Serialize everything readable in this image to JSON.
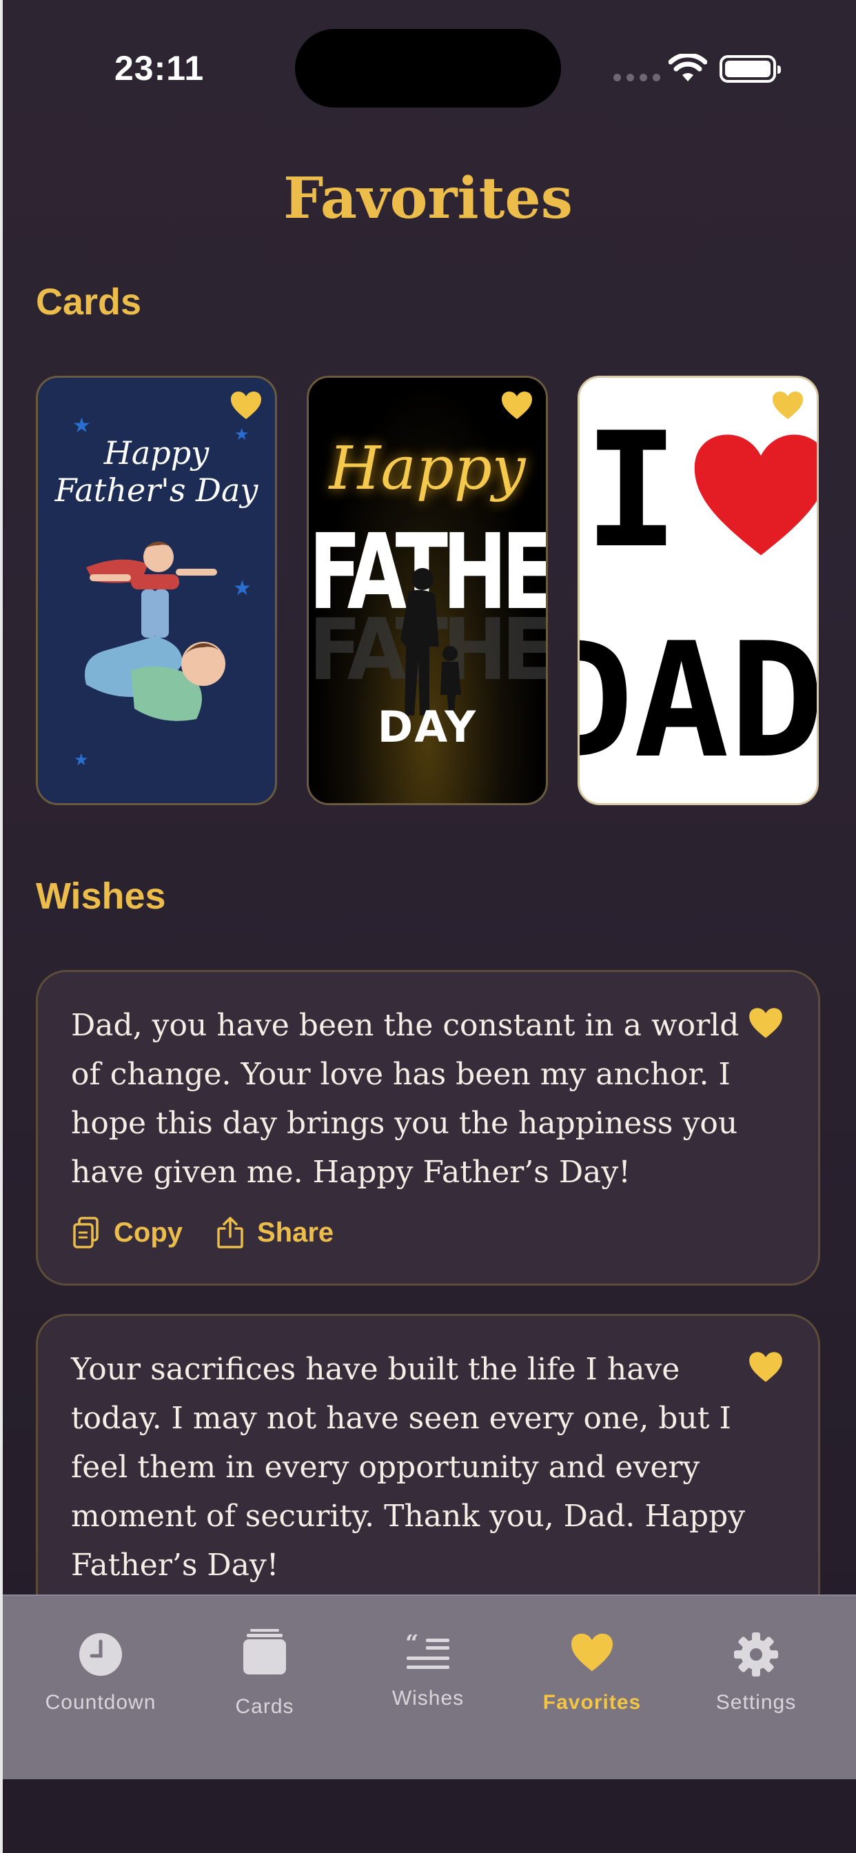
{
  "status": {
    "time": "23:11"
  },
  "page": {
    "title": "Favorites"
  },
  "sections": {
    "cards_title": "Cards",
    "wishes_title": "Wishes"
  },
  "cards": [
    {
      "name": "happy-fathers-day-blue-card",
      "text": "Happy Father's Day",
      "favorited": true
    },
    {
      "name": "happy-fathers-day-black-card",
      "happy": "Happy",
      "main": "FATHER'S",
      "day": "DAY",
      "favorited": true
    },
    {
      "name": "i-love-dad-card",
      "i": "I",
      "dad": "DAD",
      "favorited": true
    }
  ],
  "wishes": [
    {
      "text": "Dad, you have been the constant in a world of change. Your love has been my anchor. I hope this day brings you the happiness you have given me. Happy Father’s Day!",
      "copy_label": "Copy",
      "share_label": "Share",
      "favorited": true
    },
    {
      "text": "Your sacrifices have built the life I have today. I may not have seen every one, but I feel them in every opportunity and every moment of security. Thank you, Dad. Happy Father’s Day!",
      "favorited": true
    }
  ],
  "tabbar": {
    "items": [
      {
        "label": "Countdown",
        "icon": "clock-icon"
      },
      {
        "label": "Cards",
        "icon": "cards-stack-icon"
      },
      {
        "label": "Wishes",
        "icon": "quote-text-icon"
      },
      {
        "label": "Favorites",
        "icon": "heart-icon",
        "active": true
      },
      {
        "label": "Settings",
        "icon": "gear-icon"
      }
    ]
  },
  "colors": {
    "accent": "#ecbd4b",
    "background": "#2c2331",
    "card_bg": "#372d3a",
    "tabbar_bg": "#7b7481"
  }
}
